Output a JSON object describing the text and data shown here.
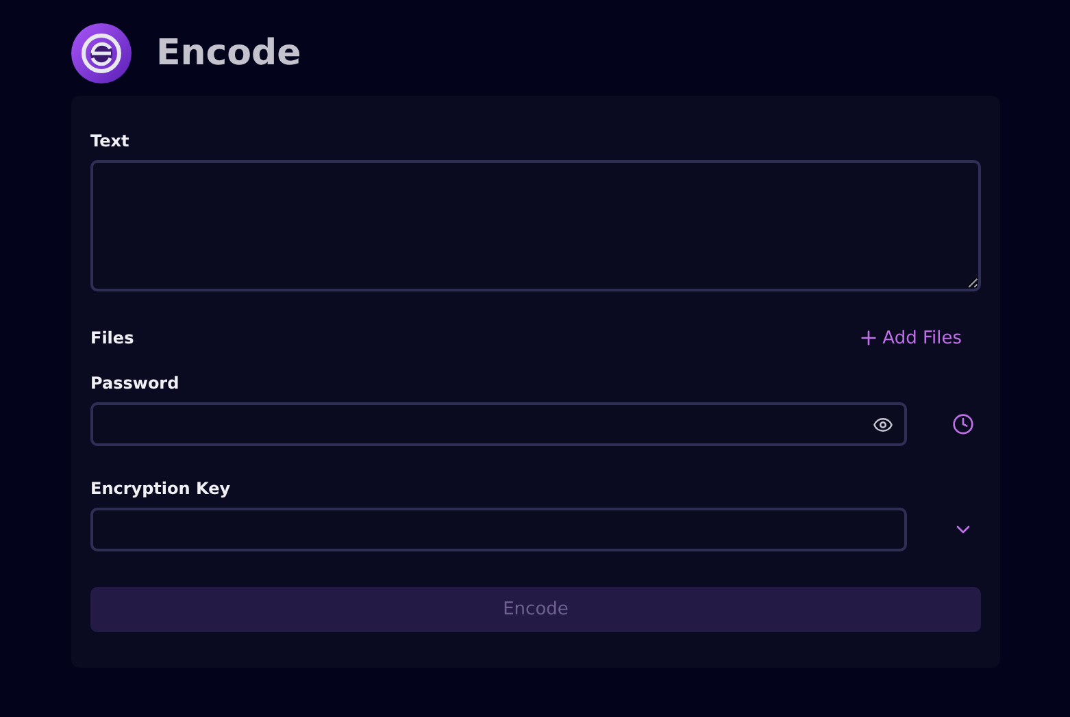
{
  "header": {
    "title": "Encode"
  },
  "text_field": {
    "label": "Text"
  },
  "files": {
    "label": "Files",
    "add_button": "Add Files"
  },
  "password": {
    "label": "Password"
  },
  "encryption_key": {
    "label": "Encryption Key"
  },
  "submit": {
    "label": "Encode",
    "disabled": true
  }
}
